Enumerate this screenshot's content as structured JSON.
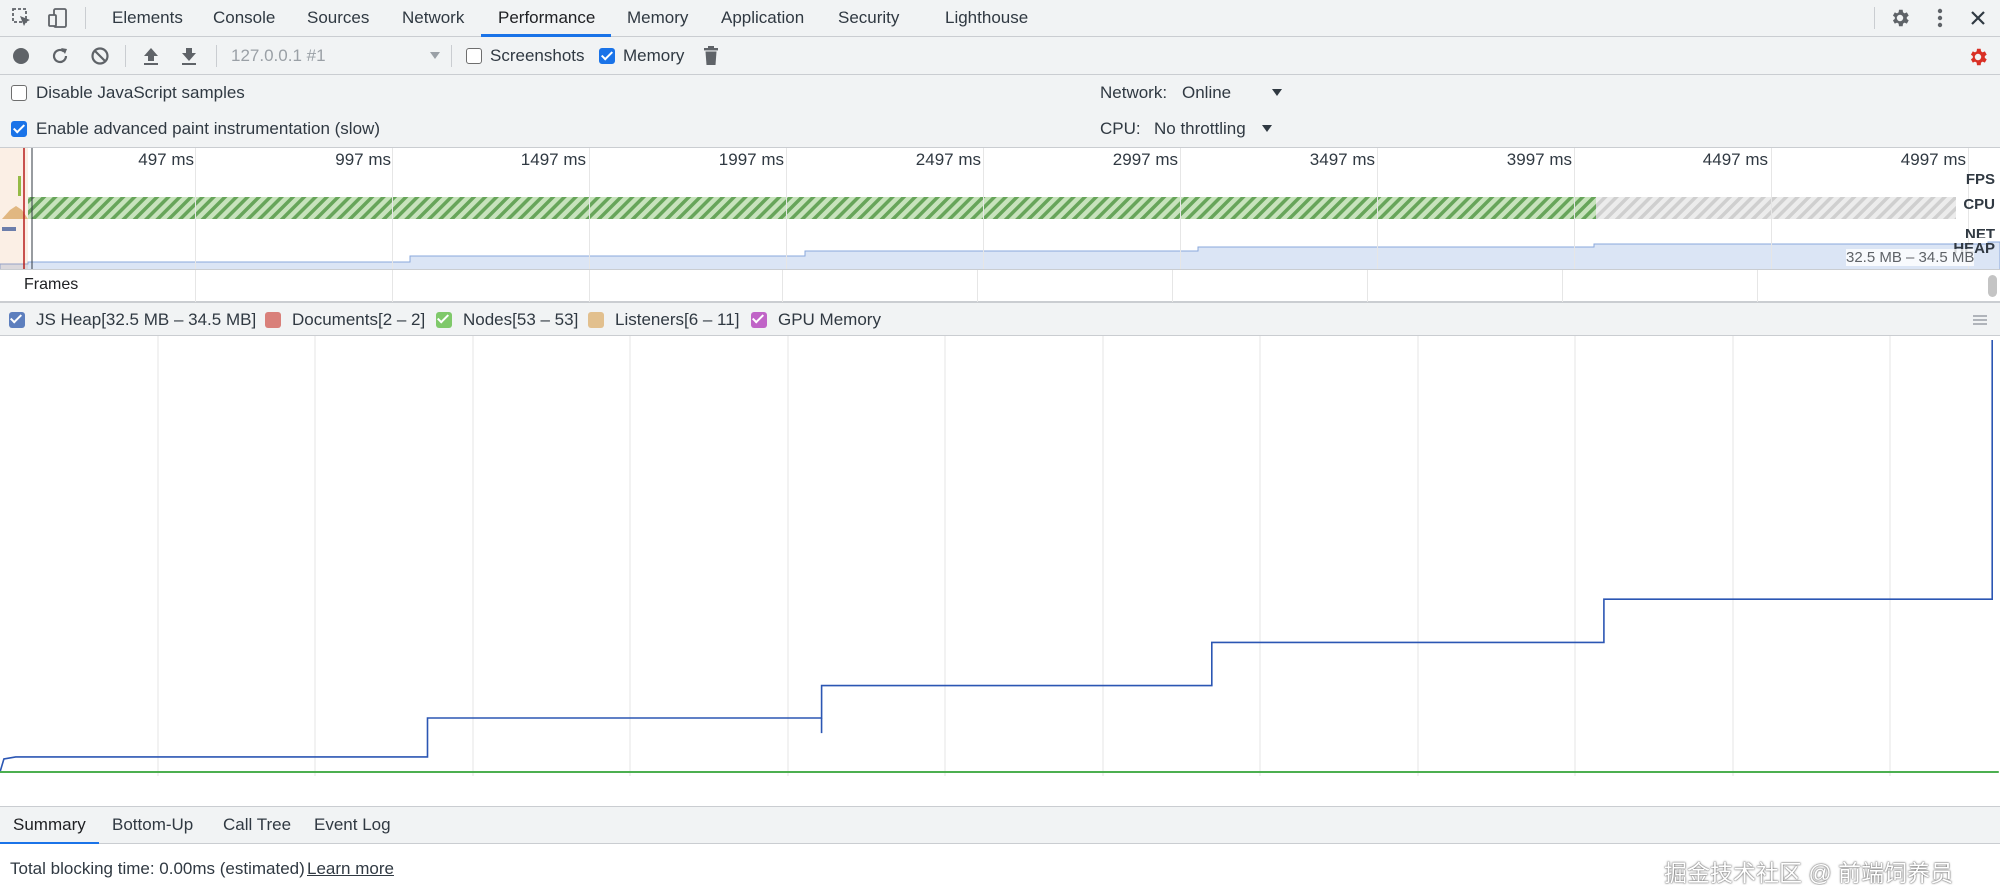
{
  "tabbar": {
    "tabs": [
      "Elements",
      "Console",
      "Sources",
      "Network",
      "Performance",
      "Memory",
      "Application",
      "Security",
      "Lighthouse"
    ],
    "active_tab": "Performance"
  },
  "toolbar": {
    "recording_select": "127.0.0.1 #1",
    "screenshots_label": "Screenshots",
    "screenshots_checked": false,
    "memory_label": "Memory",
    "memory_checked": true
  },
  "settings": {
    "disable_js_samples_label": "Disable JavaScript samples",
    "disable_js_samples_checked": false,
    "advanced_paint_label": "Enable advanced paint instrumentation (slow)",
    "advanced_paint_checked": true,
    "network_label": "Network:",
    "network_value": "Online",
    "cpu_label": "CPU:",
    "cpu_value": "No throttling"
  },
  "overview": {
    "ticks": [
      "497 ms",
      "997 ms",
      "1497 ms",
      "1997 ms",
      "2497 ms",
      "2997 ms",
      "3497 ms",
      "3997 ms",
      "4497 ms",
      "4997 ms"
    ],
    "tracks": [
      "FPS",
      "CPU",
      "NET",
      "HEAP"
    ],
    "heap_range": "32.5 MB – 34.5 MB",
    "frames_label": "Frames"
  },
  "legend": {
    "items": [
      {
        "label": "JS Heap[32.5 MB – 34.5 MB]",
        "color": "#5d7fbe",
        "checked": true
      },
      {
        "label": "Documents[2 – 2]",
        "color": "#d9807a",
        "checked": false
      },
      {
        "label": "Nodes[53 – 53]",
        "color": "#7fc96a",
        "checked": true
      },
      {
        "label": "Listeners[6 – 11]",
        "color": "#e2c08e",
        "checked": false
      },
      {
        "label": "GPU Memory",
        "color": "#c064c7",
        "checked": true
      }
    ]
  },
  "chart_data": {
    "type": "line",
    "title": "",
    "xlabel": "",
    "ylabel": "",
    "x_unit": "ms",
    "ylim_mb": [
      32.5,
      34.5
    ],
    "series": [
      {
        "name": "JS Heap",
        "color": "#2b56b3",
        "x_ms": [
          0,
          10,
          40,
          1090,
          1090,
          2095,
          2095,
          3090,
          3090,
          4090,
          4090,
          5080,
          5080
        ],
        "y_mb": [
          32.5,
          32.56,
          32.57,
          32.57,
          32.75,
          32.75,
          32.9,
          32.9,
          33.1,
          33.1,
          33.3,
          33.3,
          34.5
        ]
      },
      {
        "name": "Nodes",
        "color": "#4caf50",
        "x_ms": [
          0,
          5097
        ],
        "y_mb": [
          32.5,
          32.5
        ]
      }
    ]
  },
  "bottom_tabs": {
    "tabs": [
      "Summary",
      "Bottom-Up",
      "Call Tree",
      "Event Log"
    ],
    "active_tab": "Summary"
  },
  "status": {
    "text": "Total blocking time: 0.00ms (estimated)",
    "link": "Learn more",
    "watermark": "掘金技术社区 @ 前端饲养员"
  }
}
